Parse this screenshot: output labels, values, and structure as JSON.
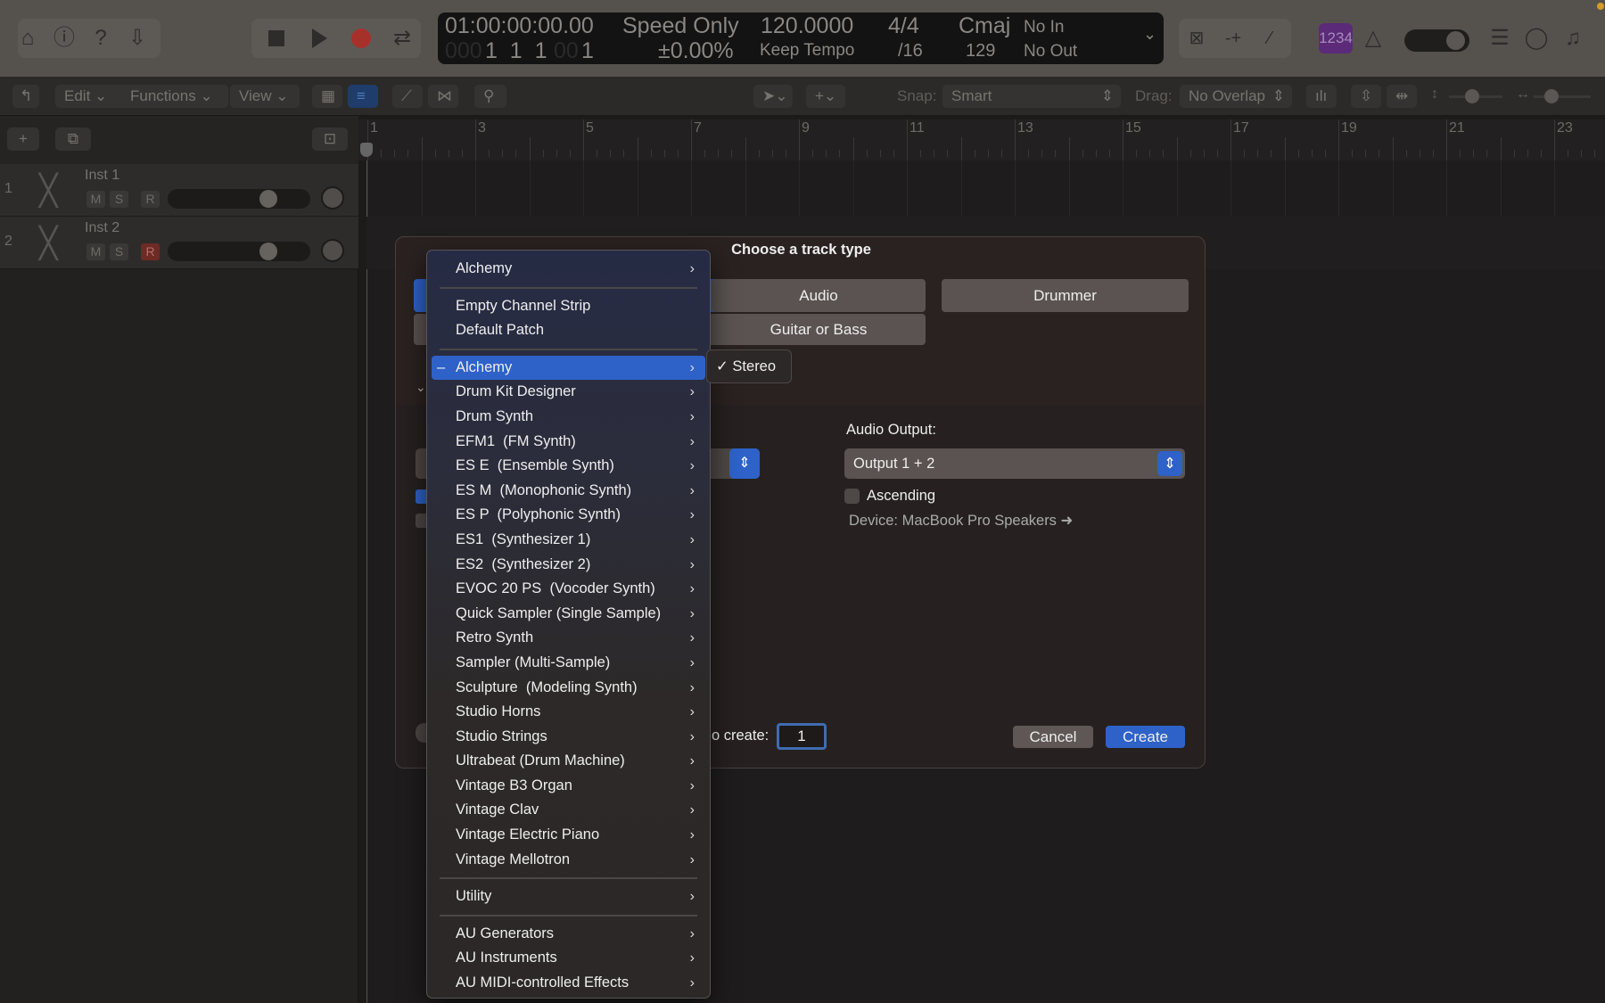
{
  "toolbar": {
    "lcd": {
      "timecode": "01:00:00:00.00",
      "bars": "1  1  1",
      "beat_sub": "1",
      "bars_dim": "000",
      "sub_dim": "00",
      "mode": "Speed Only",
      "mode_value": "±0.00%",
      "tempo": "120.0000",
      "tempo_mode": "Keep Tempo",
      "sig": "4/4",
      "division": "/16",
      "key": "Cmaj",
      "key_num": "129",
      "midi_in": "No In",
      "midi_out": "No Out"
    },
    "count_in": "1234"
  },
  "edit_bar": {
    "edit": "Edit",
    "functions": "Functions",
    "view": "View",
    "snap_label": "Snap:",
    "snap_value": "Smart",
    "drag_label": "Drag:",
    "drag_value": "No Overlap"
  },
  "tracks": [
    {
      "num": "1",
      "name": "Inst 1",
      "m": "M",
      "s": "S",
      "r": "R",
      "rec_armed": false
    },
    {
      "num": "2",
      "name": "Inst 2",
      "m": "M",
      "s": "S",
      "r": "R",
      "rec_armed": true
    }
  ],
  "ruler": {
    "labels": [
      "1",
      "3",
      "5",
      "7",
      "9",
      "11",
      "13",
      "15",
      "17",
      "19",
      "21",
      "23"
    ]
  },
  "dialog": {
    "title": "Choose a track type",
    "types": {
      "audio": "Audio",
      "guitar": "Guitar or Bass",
      "drummer": "Drummer"
    },
    "audio_output_label": "Audio Output:",
    "audio_output_value": "Output 1 + 2",
    "ascending_label": "Ascending",
    "device": "Device: MacBook Pro Speakers",
    "create_count_label": "o create:",
    "create_count_value": "1",
    "cancel": "Cancel",
    "create": "Create"
  },
  "menu": {
    "items": [
      {
        "label": "Alchemy",
        "submenu": true
      },
      {
        "sep": true
      },
      {
        "label": "Empty Channel Strip"
      },
      {
        "label": "Default Patch"
      },
      {
        "sep": true
      },
      {
        "label": "Alchemy",
        "submenu": true,
        "selected": true,
        "mark": "–"
      },
      {
        "label": "Drum Kit Designer",
        "submenu": true
      },
      {
        "label": "Drum Synth",
        "submenu": true
      },
      {
        "label": "EFM1  (FM Synth)",
        "submenu": true
      },
      {
        "label": "ES E  (Ensemble Synth)",
        "submenu": true
      },
      {
        "label": "ES M  (Monophonic Synth)",
        "submenu": true
      },
      {
        "label": "ES P  (Polyphonic Synth)",
        "submenu": true
      },
      {
        "label": "ES1  (Synthesizer 1)",
        "submenu": true
      },
      {
        "label": "ES2  (Synthesizer 2)",
        "submenu": true
      },
      {
        "label": "EVOC 20 PS  (Vocoder Synth)",
        "submenu": true
      },
      {
        "label": "Quick Sampler (Single Sample)",
        "submenu": true
      },
      {
        "label": "Retro Synth",
        "submenu": true
      },
      {
        "label": "Sampler (Multi-Sample)",
        "submenu": true
      },
      {
        "label": "Sculpture  (Modeling Synth)",
        "submenu": true
      },
      {
        "label": "Studio Horns",
        "submenu": true
      },
      {
        "label": "Studio Strings",
        "submenu": true
      },
      {
        "label": "Ultrabeat (Drum Machine)",
        "submenu": true
      },
      {
        "label": "Vintage B3 Organ",
        "submenu": true
      },
      {
        "label": "Vintage Clav",
        "submenu": true
      },
      {
        "label": "Vintage Electric Piano",
        "submenu": true
      },
      {
        "label": "Vintage Mellotron",
        "submenu": true
      },
      {
        "sep": true
      },
      {
        "label": "Utility",
        "submenu": true
      },
      {
        "sep": true
      },
      {
        "label": "AU Generators",
        "submenu": true
      },
      {
        "label": "AU Instruments",
        "submenu": true
      },
      {
        "label": "AU MIDI-controlled Effects",
        "submenu": true
      }
    ],
    "submenu": {
      "check": "✓",
      "label": "Stereo"
    }
  },
  "colors": {
    "accent": "#2e62c9",
    "record": "#a8302a",
    "count_in": "#5b2a78"
  }
}
